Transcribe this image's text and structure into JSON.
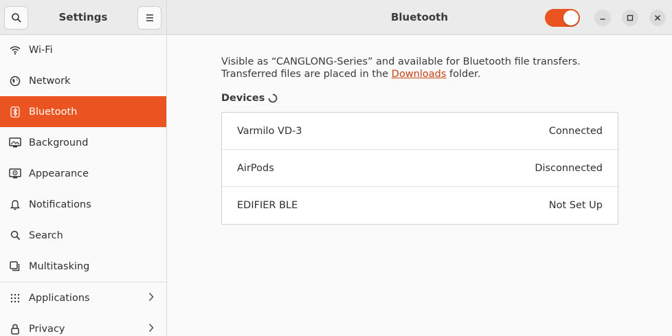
{
  "sidebar": {
    "title": "Settings",
    "items": [
      {
        "label": "Wi-Fi",
        "icon": "wifi-icon"
      },
      {
        "label": "Network",
        "icon": "network-icon"
      },
      {
        "label": "Bluetooth",
        "icon": "bluetooth-icon",
        "active": true
      },
      {
        "label": "Background",
        "icon": "background-icon"
      },
      {
        "label": "Appearance",
        "icon": "appearance-icon"
      },
      {
        "label": "Notifications",
        "icon": "bell-icon"
      },
      {
        "label": "Search",
        "icon": "search-icon"
      },
      {
        "label": "Multitasking",
        "icon": "multitasking-icon"
      },
      {
        "label": "Applications",
        "icon": "apps-grid-icon",
        "has_submenu": true
      },
      {
        "label": "Privacy",
        "icon": "privacy-icon",
        "has_submenu": true
      }
    ]
  },
  "header": {
    "title": "Bluetooth",
    "bluetooth_enabled": true
  },
  "main": {
    "desc_before": "Visible as “CANGLONG-Series” and available for Bluetooth file transfers. Transferred files are placed in the ",
    "desc_link": "Downloads",
    "desc_after": " folder.",
    "devices_label": "Devices",
    "devices": [
      {
        "name": "Varmilo VD-3",
        "status": "Connected"
      },
      {
        "name": "AirPods",
        "status": "Disconnected"
      },
      {
        "name": "EDIFIER BLE",
        "status": "Not Set Up"
      }
    ]
  },
  "colors": {
    "accent": "#e95420"
  }
}
